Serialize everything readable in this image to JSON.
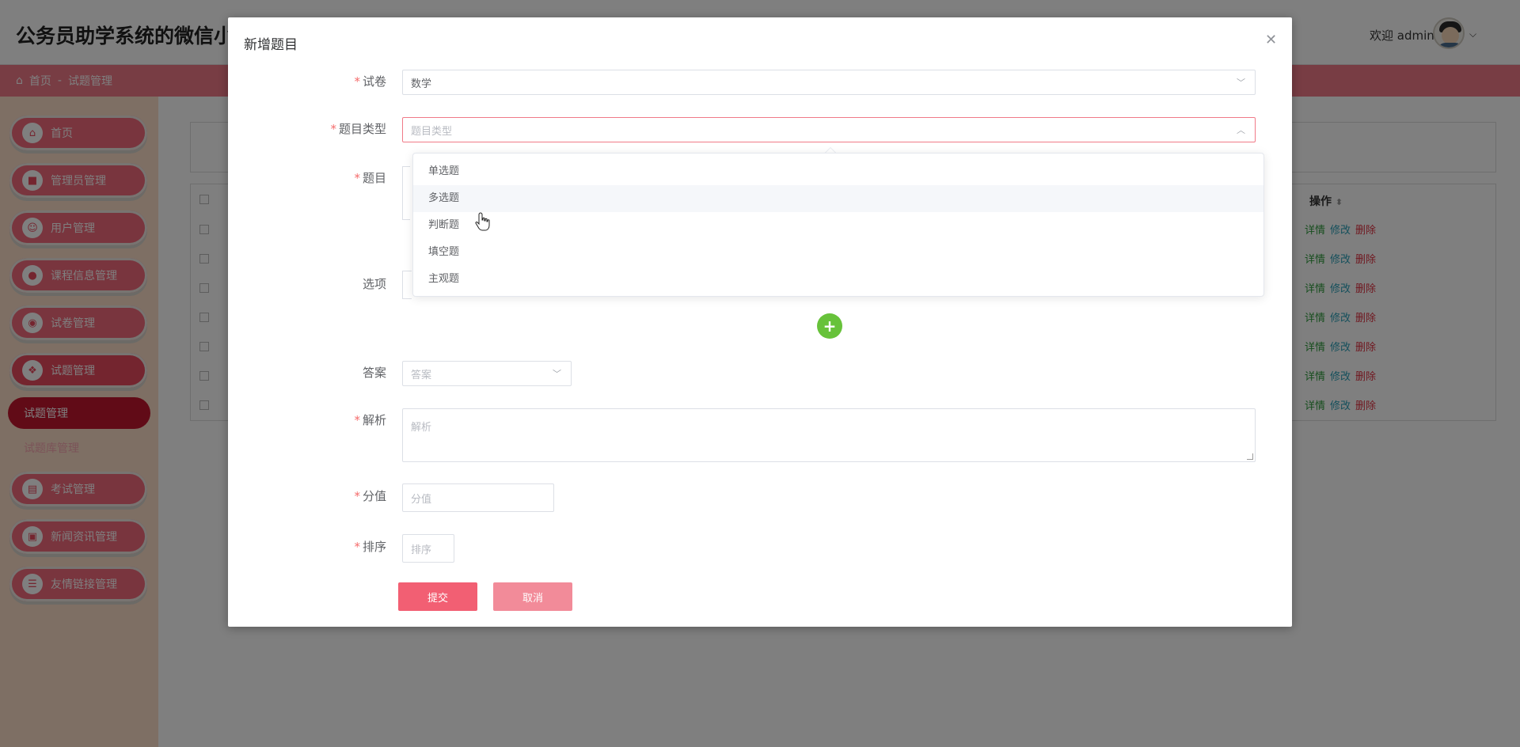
{
  "app": {
    "title": "公务员助学系统的微信小",
    "welcome": "欢迎 admin"
  },
  "breadcrumb": {
    "home": "首页",
    "separator": "-",
    "current": "试题管理"
  },
  "sidebar": {
    "items": [
      {
        "label": "首页",
        "icon": "home-icon"
      },
      {
        "label": "管理员管理",
        "icon": "admin-icon"
      },
      {
        "label": "用户管理",
        "icon": "user-icon"
      },
      {
        "label": "课程信息管理",
        "icon": "course-icon"
      },
      {
        "label": "试卷管理",
        "icon": "paper-icon"
      },
      {
        "label": "试题管理",
        "icon": "question-icon"
      }
    ],
    "sub_items": [
      {
        "label": "试题管理"
      },
      {
        "label": "试题库管理"
      }
    ],
    "items_after": [
      {
        "label": "考试管理",
        "icon": "exam-icon"
      },
      {
        "label": "新闻资讯管理",
        "icon": "news-icon"
      },
      {
        "label": "友情链接管理",
        "icon": "link-icon"
      }
    ]
  },
  "table": {
    "ops_header": "操作",
    "row_ops": {
      "detail": "详情",
      "edit": "修改",
      "delete": "删除"
    },
    "row_count": 7
  },
  "dialog": {
    "title": "新增题目",
    "fields": {
      "paper": {
        "label": "试卷",
        "value": "数学"
      },
      "type": {
        "label": "题目类型",
        "placeholder": "题目类型"
      },
      "question": {
        "label": "题目"
      },
      "options": {
        "label": "选项"
      },
      "answer": {
        "label": "答案",
        "placeholder": "答案"
      },
      "analysis": {
        "label": "解析",
        "placeholder": "解析"
      },
      "score": {
        "label": "分值",
        "placeholder": "分值"
      },
      "order": {
        "label": "排序",
        "placeholder": "排序"
      }
    },
    "type_options": [
      "单选题",
      "多选题",
      "判断题",
      "填空题",
      "主观题"
    ],
    "hovered_option_index": 1,
    "submit_label": "提交",
    "cancel_label": "取消"
  },
  "colors": {
    "accent": "#f07a88",
    "menu": "#f26a7c",
    "submit": "#f25f73",
    "cancel": "#f28b99",
    "add_button": "#67c23a"
  }
}
